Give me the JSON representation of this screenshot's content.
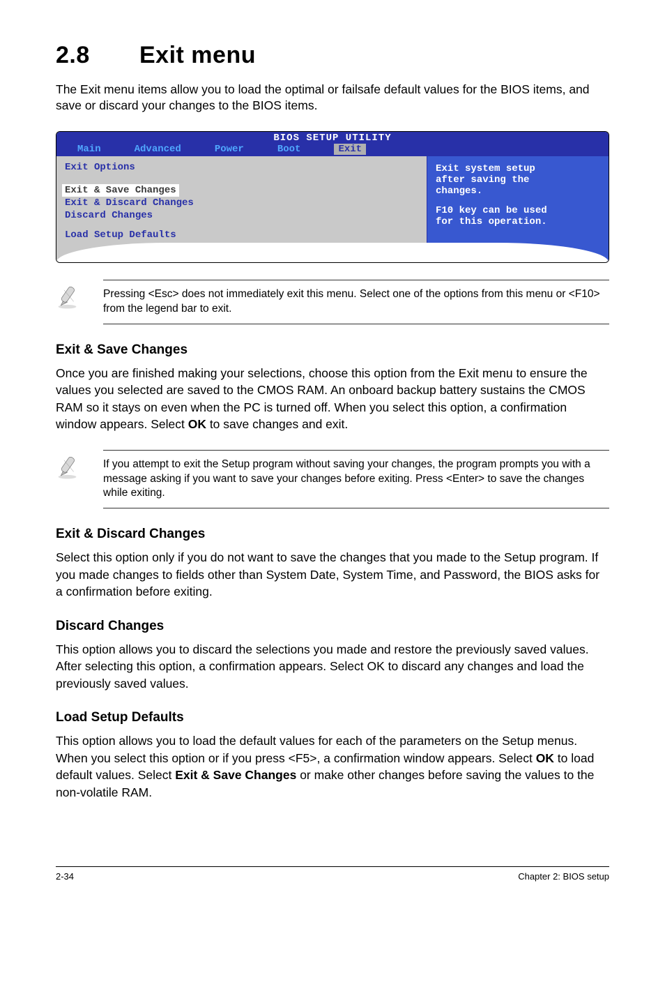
{
  "heading": {
    "number": "2.8",
    "title": "Exit menu"
  },
  "intro": "The Exit menu items allow you to load the optimal or failsafe default values for the BIOS items, and save or discard your changes to the BIOS items.",
  "bios": {
    "title": "BIOS SETUP UTILITY",
    "tabs": [
      "Main",
      "Advanced",
      "Power",
      "Boot",
      "Exit"
    ],
    "left_title": "Exit Options",
    "options": [
      "Exit & Save Changes",
      "Exit & Discard Changes",
      "Discard Changes",
      "Load Setup Defaults"
    ],
    "right_lines": [
      "Exit system setup",
      "after saving the",
      "changes.",
      "",
      "F10 key can be used",
      "for this operation."
    ]
  },
  "note1": "Pressing <Esc> does not immediately exit this menu. Select one of the options from this menu or <F10> from the legend bar to exit.",
  "sec1": {
    "head": "Exit & Save Changes",
    "body_parts": [
      "Once you are finished making your selections, choose this option from the Exit menu to ensure the values you selected are saved to the CMOS RAM. An onboard backup battery sustains the CMOS RAM so it stays on even when the PC is turned off. When you select this option, a confirmation window appears. Select ",
      "OK",
      " to save changes and exit."
    ]
  },
  "note2": " If you attempt to exit the Setup program without saving your changes, the program prompts you with a message asking if you want to save your changes before exiting. Press <Enter>  to save the  changes while exiting.",
  "sec2": {
    "head": "Exit & Discard Changes",
    "body": "Select this option only if you do not want to save the changes that you  made to the Setup program. If you made changes to fields other than System Date, System Time, and Password, the BIOS asks for a confirmation before exiting."
  },
  "sec3": {
    "head": "Discard Changes",
    "body_parts": [
      "This option allows you to discard the selections you made and restore the previously saved values. After selecting this option, a confirmation appears. Select ",
      "OK",
      " to discard any changes and load the previously saved values."
    ]
  },
  "sec4": {
    "head": "Load Setup Defaults",
    "body_parts": [
      "This option allows you to load the default values for each of the parameters on the Setup menus. When you select this option or if you press <F5>, a confirmation window appears. Select ",
      "OK",
      " to load default values. Select ",
      "Exit & Save Changes",
      " or make other changes before saving the values to the non-volatile RAM."
    ]
  },
  "footer": {
    "left": "2-34",
    "right": "Chapter 2: BIOS setup"
  }
}
